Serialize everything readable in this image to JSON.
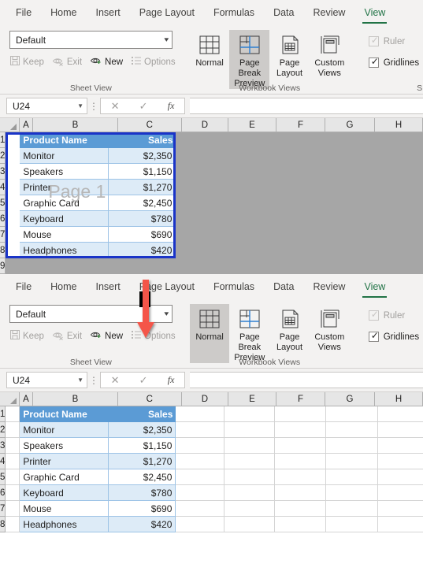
{
  "ribbon": {
    "tabs": [
      "File",
      "Home",
      "Insert",
      "Page Layout",
      "Formulas",
      "Data",
      "Review",
      "View"
    ],
    "active_tab": "View",
    "accent_color": "#217346"
  },
  "sheet_view": {
    "group_label": "Sheet View",
    "combo_value": "Default",
    "buttons": [
      {
        "label": "Keep",
        "icon": "save-icon",
        "enabled": false
      },
      {
        "label": "Exit",
        "icon": "eye-exit-icon",
        "enabled": false
      },
      {
        "label": "New",
        "icon": "eye-new-icon",
        "enabled": true
      },
      {
        "label": "Options",
        "icon": "list-options-icon",
        "enabled": false
      }
    ]
  },
  "workbook_views": {
    "group_label": "Workbook Views",
    "buttons": [
      {
        "label": "Normal",
        "icon": "normal-view-icon"
      },
      {
        "label": "Page Break Preview",
        "icon": "page-break-preview-icon"
      },
      {
        "label": "Page Layout",
        "icon": "page-layout-icon"
      },
      {
        "label": "Custom Views",
        "icon": "custom-views-icon"
      }
    ],
    "selected_top": "Page Break Preview",
    "selected_bottom": "Normal"
  },
  "show_group": {
    "group_label": "S",
    "items": [
      {
        "label": "Ruler",
        "checked": true,
        "enabled": false
      },
      {
        "label": "Gridlines",
        "checked": true,
        "enabled": true
      }
    ]
  },
  "formula_bar": {
    "name_box": "U24",
    "formula_value": "",
    "cancel_icon": "cancel-icon",
    "confirm_icon": "confirm-icon",
    "function_icon": "fx-icon"
  },
  "grid": {
    "column_headers": [
      "A",
      "B",
      "C",
      "D",
      "E",
      "F",
      "G",
      "H"
    ],
    "row_headers_top": [
      "1",
      "2",
      "3",
      "4",
      "5",
      "6",
      "7",
      "8",
      "9"
    ],
    "row_headers_bottom": [
      "1",
      "2",
      "3",
      "4",
      "5",
      "6",
      "7",
      "8"
    ],
    "watermark": "Page 1",
    "table": {
      "headers": [
        "Product Name",
        "Sales"
      ],
      "rows": [
        [
          "Monitor",
          "$2,350"
        ],
        [
          "Speakers",
          "$1,150"
        ],
        [
          "Printer",
          "$1,270"
        ],
        [
          "Graphic Card",
          "$2,450"
        ],
        [
          "Keyboard",
          "$780"
        ],
        [
          "Mouse",
          "$690"
        ],
        [
          "Headphones",
          "$420"
        ]
      ]
    },
    "colors": {
      "header_fill": "#5b9bd5",
      "band_fill": "#ddebf7",
      "page_break_border": "#1a34c8",
      "outside_print_area": "#a6a6a6"
    }
  },
  "annotation": {
    "arrow": "down-arrow",
    "arrow_color": "#f4554a"
  }
}
